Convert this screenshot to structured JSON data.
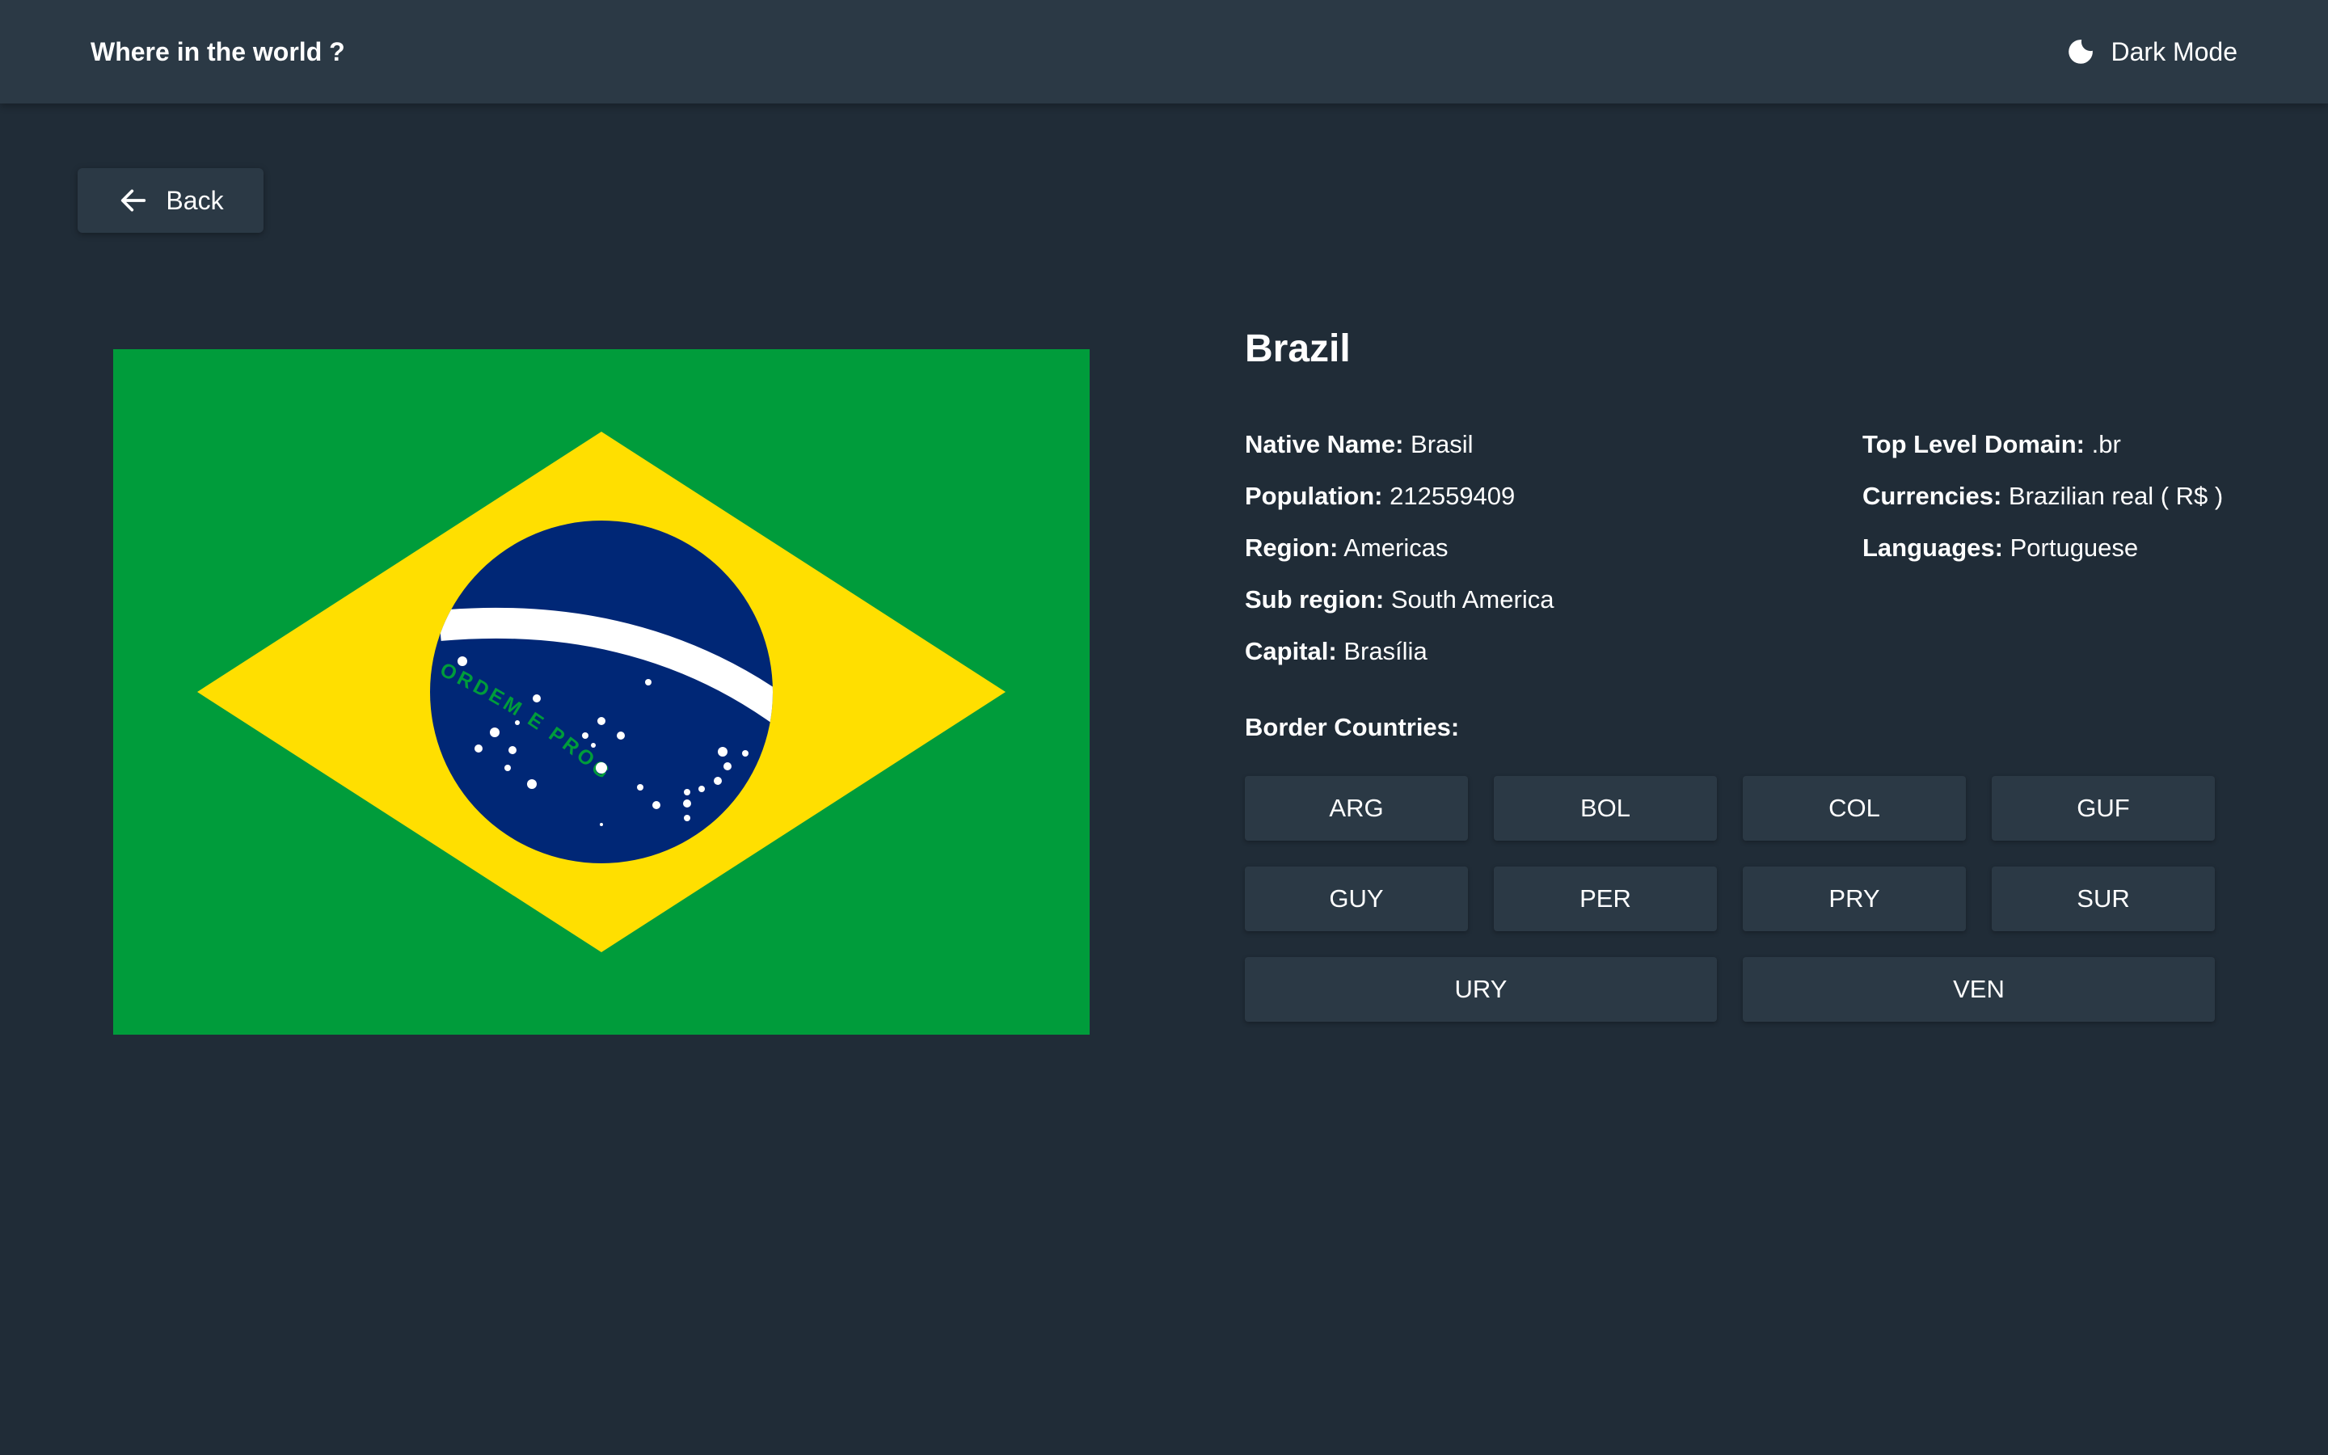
{
  "header": {
    "title": "Where in the world ?",
    "theme_toggle_label": "Dark Mode",
    "theme_icon": "moon-icon"
  },
  "back_button": {
    "label": "Back",
    "icon": "arrow-left-icon"
  },
  "flag": {
    "motto": "ORDEM E PROGRESSO",
    "colors": {
      "green": "#009c3b",
      "yellow": "#ffdf00",
      "blue": "#002776",
      "white": "#ffffff"
    }
  },
  "country": {
    "name": "Brazil",
    "details_left": [
      {
        "label": "Native Name:",
        "value": "Brasil"
      },
      {
        "label": "Population:",
        "value": "212559409"
      },
      {
        "label": "Region:",
        "value": "Americas"
      },
      {
        "label": "Sub region:",
        "value": "South America"
      },
      {
        "label": "Capital:",
        "value": "Brasília"
      }
    ],
    "details_right": [
      {
        "label": "Top Level Domain:",
        "value": ".br"
      },
      {
        "label": "Currencies:",
        "value": "Brazilian real ( R$ )"
      },
      {
        "label": "Languages:",
        "value": "Portuguese"
      }
    ]
  },
  "border_countries": {
    "title": "Border Countries:",
    "items": [
      "ARG",
      "BOL",
      "COL",
      "GUF",
      "GUY",
      "PER",
      "PRY",
      "SUR",
      "URY",
      "VEN"
    ]
  },
  "theme": {
    "background": "#202c37",
    "elements": "#2b3945",
    "text": "#ffffff"
  }
}
